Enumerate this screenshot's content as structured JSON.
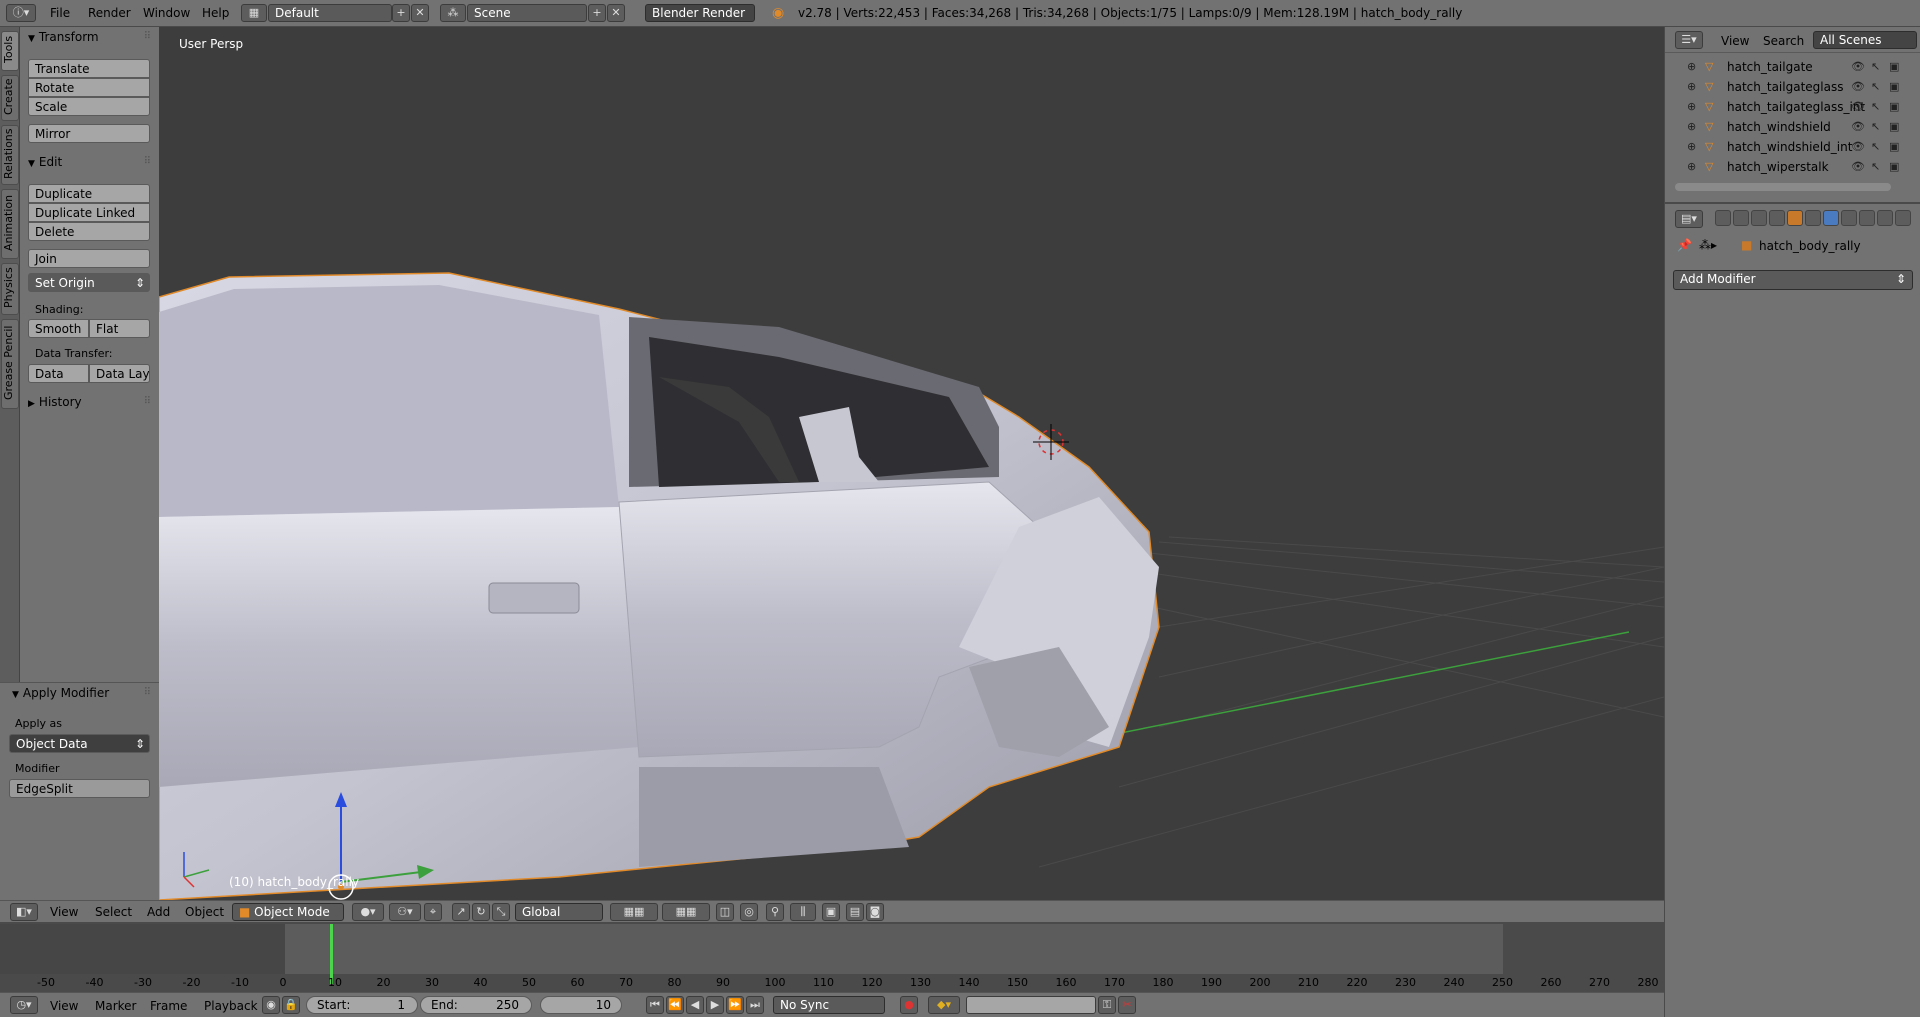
{
  "header": {
    "menus": [
      "File",
      "Render",
      "Window",
      "Help"
    ],
    "layout": "Default",
    "scene": "Scene",
    "engine": "Blender Render",
    "stats": "v2.78 | Verts:22,453 | Faces:34,268 | Tris:34,268 | Objects:1/75 | Lamps:0/9 | Mem:128.19M | hatch_body_rally"
  },
  "tool_tabs": [
    "Tools",
    "Create",
    "Relations",
    "Animation",
    "Physics",
    "Grease Pencil"
  ],
  "toolshelf": {
    "transform_title": "Transform",
    "translate": "Translate",
    "rotate": "Rotate",
    "scale": "Scale",
    "mirror": "Mirror",
    "edit_title": "Edit",
    "duplicate": "Duplicate",
    "duplicate_linked": "Duplicate Linked",
    "delete": "Delete",
    "join": "Join",
    "set_origin": "Set Origin",
    "shading_label": "Shading:",
    "smooth": "Smooth",
    "flat": "Flat",
    "data_transfer_label": "Data Transfer:",
    "data": "Data",
    "data_layout": "Data Layo",
    "history_title": "History"
  },
  "operator_panel": {
    "title": "Apply Modifier",
    "apply_as_label": "Apply as",
    "apply_as_value": "Object Data",
    "modifier_label": "Modifier",
    "modifier_value": "EdgeSplit"
  },
  "viewport": {
    "view_name": "User Persp",
    "object_label": "(10) hatch_body_rally"
  },
  "view_header": {
    "menus": [
      "View",
      "Select",
      "Add",
      "Object"
    ],
    "mode": "Object Mode",
    "orientation": "Global"
  },
  "timeline": {
    "ticks": [
      "-50",
      "-40",
      "-30",
      "-20",
      "-10",
      "0",
      "10",
      "20",
      "30",
      "40",
      "50",
      "60",
      "70",
      "80",
      "90",
      "100",
      "110",
      "120",
      "130",
      "140",
      "150",
      "160",
      "170",
      "180",
      "190",
      "200",
      "210",
      "220",
      "230",
      "240",
      "250",
      "260",
      "270",
      "280"
    ],
    "current_frame": 10,
    "menus": [
      "View",
      "Marker",
      "Frame",
      "Playback"
    ],
    "start_label": "Start:",
    "start_value": "1",
    "end_label": "End:",
    "end_value": "250",
    "frame_value": "10",
    "sync": "No Sync"
  },
  "outliner": {
    "menus": [
      "View",
      "Search"
    ],
    "filter": "All Scenes",
    "rows": [
      "hatch_tailgate",
      "hatch_tailgateglass",
      "hatch_tailgateglass_int",
      "hatch_windshield",
      "hatch_windshield_int",
      "hatch_wiperstalk"
    ]
  },
  "properties": {
    "object_name": "hatch_body_rally",
    "add_modifier": "Add Modifier"
  },
  "colors": {
    "accent_orange": "#e08a2a",
    "axis_green": "#3ca03c",
    "axis_blue": "#2a4de0"
  }
}
